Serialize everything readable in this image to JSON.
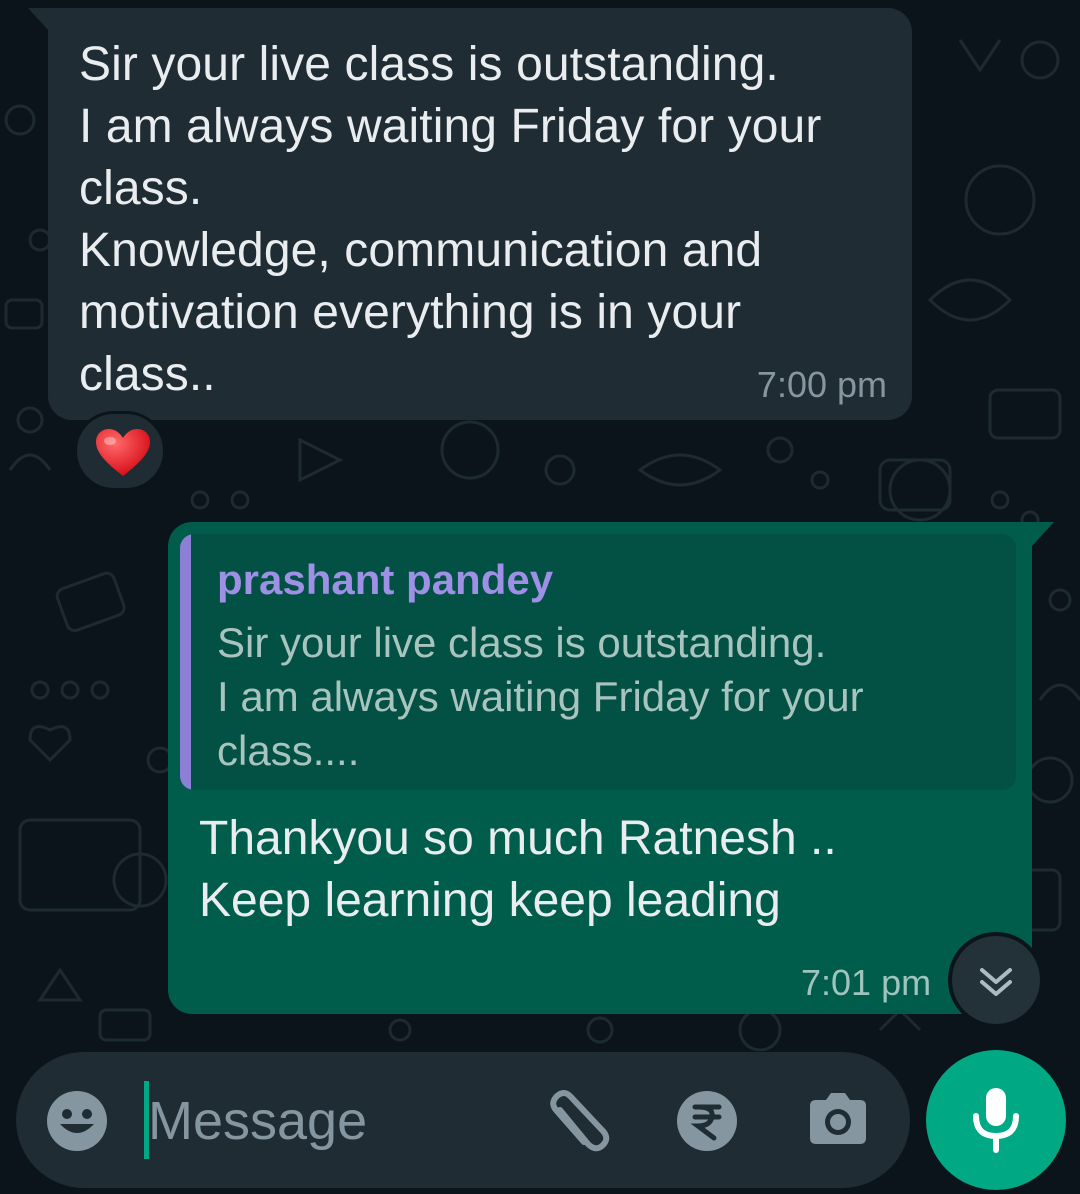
{
  "messages": {
    "incoming": {
      "text": "Sir your live class is outstanding.\nI am always waiting Friday for your class.\nKnowledge, communication and motivation everything is in your class..",
      "time": "7:00 pm",
      "reaction_icon": "red-heart-emoji"
    },
    "outgoing": {
      "quoted_author": "prashant pandey",
      "quoted_text": "Sir your live class is outstanding.\nI am always waiting Friday for your class....",
      "text": "Thankyou so much Ratnesh ..\nKeep learning keep leading",
      "time": "7:01 pm"
    }
  },
  "composer": {
    "placeholder": "Message",
    "icons": [
      "emoji-icon",
      "attach-icon",
      "rupee-payment-icon",
      "camera-icon",
      "mic-icon"
    ]
  },
  "colors": {
    "background": "#0b141a",
    "incoming_bubble": "#202c33",
    "outgoing_bubble": "#005c4b",
    "accent": "#00a884",
    "quote_author": "#9e90e4"
  }
}
